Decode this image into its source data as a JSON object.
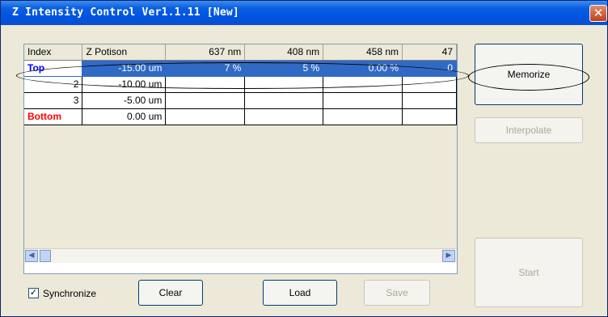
{
  "window": {
    "title": "Z Intensity Control Ver1.1.11 [New]",
    "close_glyph": "✕"
  },
  "table": {
    "headers": [
      "Index",
      "Z Potison",
      "637  nm",
      "408  nm",
      "458  nm",
      "47"
    ],
    "rows": [
      {
        "index": "Top",
        "z": "-15.00  um",
        "c637": "7 %",
        "c408": "5 %",
        "c458": "0.00 %",
        "c47": "0"
      },
      {
        "index": "2",
        "z": "-10.00  um",
        "c637": "",
        "c408": "",
        "c458": "",
        "c47": ""
      },
      {
        "index": "3",
        "z": "-5.00  um",
        "c637": "",
        "c408": "",
        "c458": "",
        "c47": ""
      },
      {
        "index": "Bottom",
        "z": "0.00  um",
        "c637": "",
        "c408": "",
        "c458": "",
        "c47": ""
      }
    ]
  },
  "scrollbar": {
    "left_glyph": "◀",
    "right_glyph": "▶"
  },
  "buttons": {
    "memorize": "Memorize",
    "interpolate": "Interpolate",
    "start": "Start",
    "clear": "Clear",
    "load": "Load",
    "save": "Save"
  },
  "synchronize": {
    "label": "Synchronize",
    "checked": true,
    "check_glyph": "✓"
  },
  "colors": {
    "selection": "#316ac5",
    "top_label": "#0000ff",
    "bottom_label": "#ff0000",
    "title_bar": "#0054e3"
  }
}
